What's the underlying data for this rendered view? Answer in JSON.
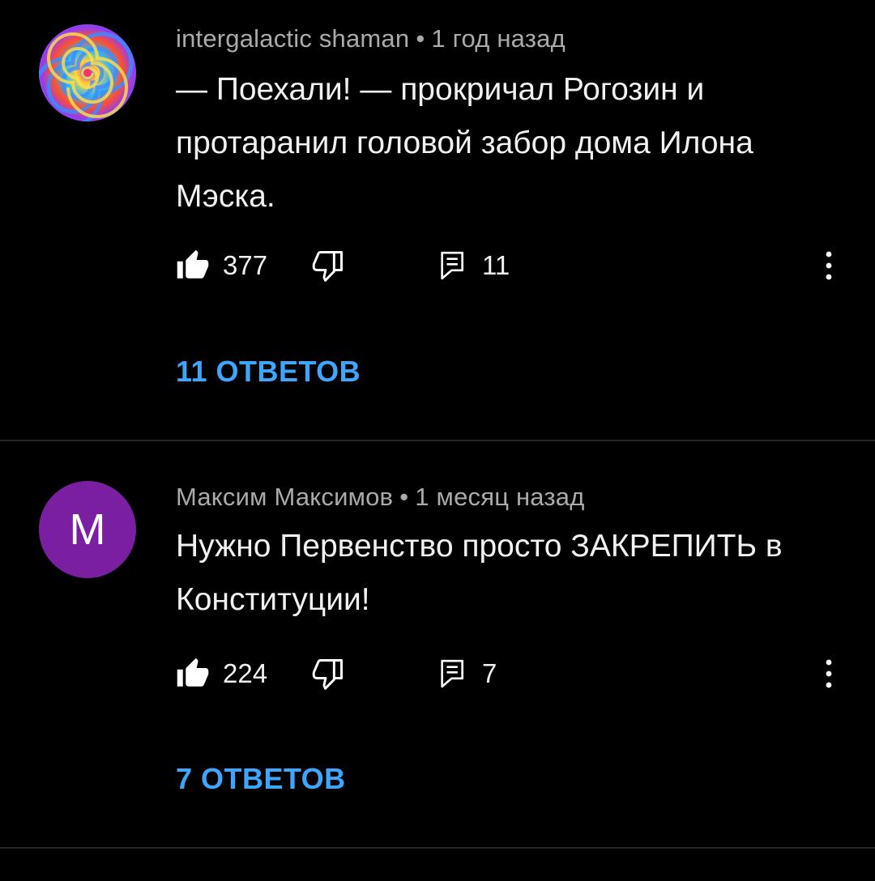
{
  "comments": [
    {
      "author": "intergalactic shaman",
      "separator": "•",
      "time": "1 год назад",
      "text": "— Поехали! — прокричал Рогозин и протаранил головой забор дома Илона Мэска.",
      "likes": "377",
      "replies_count": "11",
      "replies_link": "11 ОТВЕТОВ",
      "avatar_type": "tie-dye-spiral"
    },
    {
      "author": "Максим Максимов",
      "separator": "•",
      "time": "1 месяц назад",
      "text": "Нужно Первенство просто ЗАКРЕПИТЬ в Конституции!",
      "likes": "224",
      "replies_count": "7",
      "replies_link": "7 ОТВЕТОВ",
      "avatar_letter": "М",
      "avatar_color": "#7b1fa2"
    }
  ],
  "icons": {
    "like": "thumbs-up-filled-icon",
    "dislike": "thumbs-down-outline-icon",
    "reply": "comment-reply-icon",
    "more": "three-dots-vertical-icon"
  },
  "colors": {
    "background": "#000000",
    "text": "#f1f1f1",
    "meta": "#aaaaaa",
    "link": "#3ea6ff",
    "divider": "#262626"
  }
}
